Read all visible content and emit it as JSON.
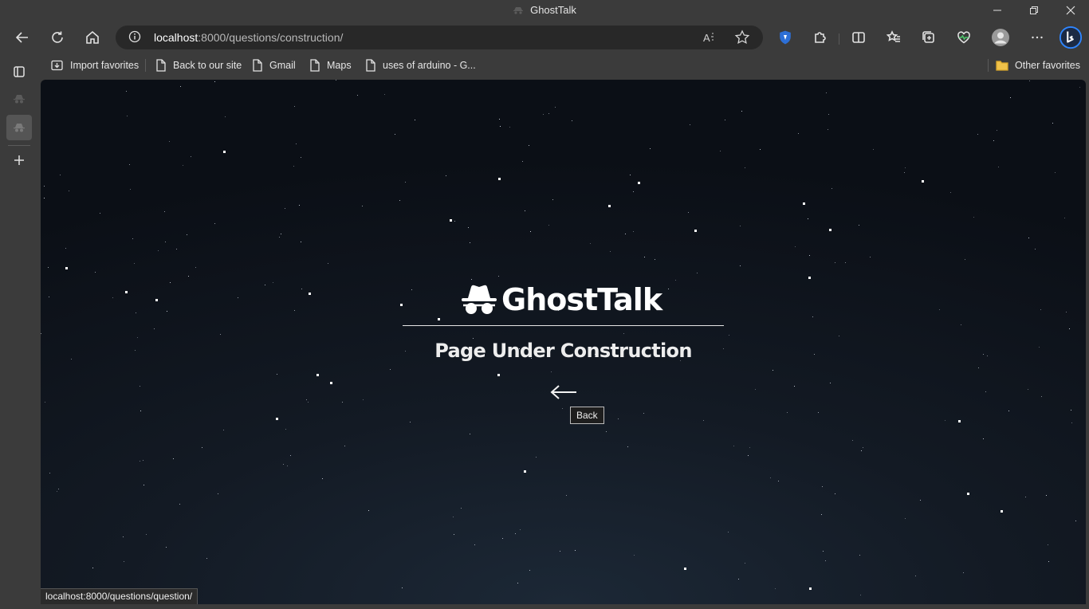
{
  "window": {
    "title": "GhostTalk",
    "controls": [
      "minimize",
      "restore",
      "close"
    ]
  },
  "toolbar": {
    "back_icon": "arrow-left-icon",
    "refresh_icon": "refresh-icon",
    "home_icon": "home-icon",
    "address": {
      "host": "localhost",
      "path": ":8000/questions/construction/"
    },
    "right_icons": [
      "read-aloud-icon",
      "favorite-star-icon",
      "shield-extension-icon",
      "extensions-icon",
      "split-screen-icon",
      "favorites-icon",
      "collections-icon",
      "browser-essentials-icon",
      "profile-avatar-icon",
      "more-menu-icon",
      "bing-copilot-icon"
    ]
  },
  "bookmarks": {
    "import": "Import favorites",
    "items": [
      "Back to our site",
      "Gmail",
      "Maps",
      "uses of arduino - G..."
    ],
    "other": "Other favorites"
  },
  "sidebar": {
    "icons": [
      "tab-actions-icon",
      "incognito-tab-icon",
      "incognito-tab-active-icon",
      "new-tab-plus-icon"
    ]
  },
  "page": {
    "brand": "GhostTalk",
    "heading": "Page Under Construction",
    "back_tooltip": "Back"
  },
  "status_url": "localhost:8000/questions/question/",
  "colors": {
    "chrome_bg": "#3b3b3b",
    "address_bg": "#282828",
    "page_bg_center": "#1c2836",
    "page_bg_edge": "#0b0f16"
  }
}
